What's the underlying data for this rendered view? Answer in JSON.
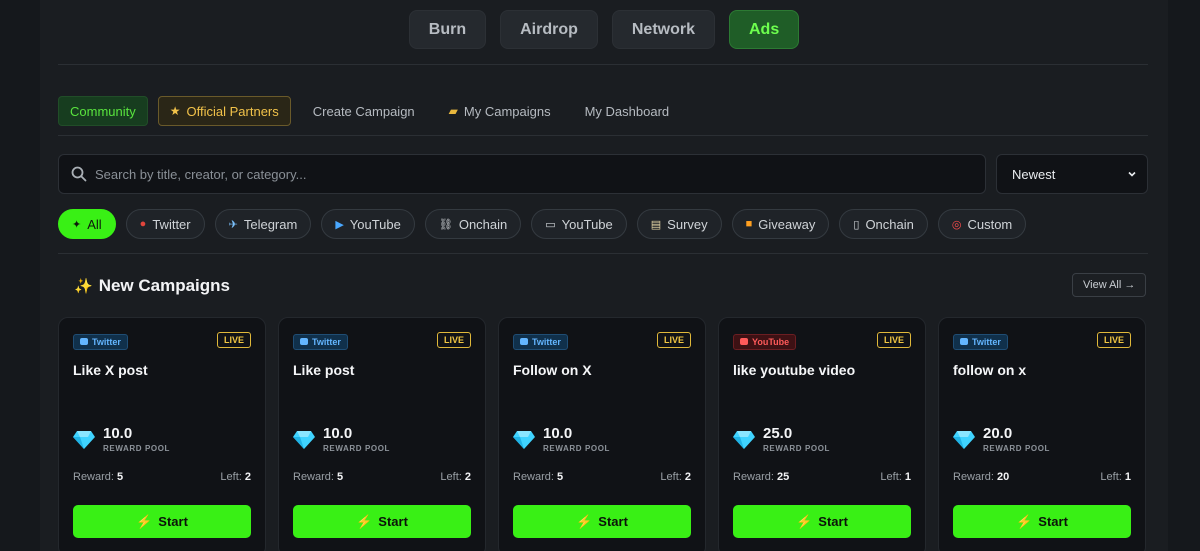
{
  "topnav": [
    {
      "label": "Burn",
      "active": false
    },
    {
      "label": "Airdrop",
      "active": false
    },
    {
      "label": "Network",
      "active": false
    },
    {
      "label": "Ads",
      "active": true
    }
  ],
  "subnav": {
    "community": "Community",
    "partners": "Official Partners",
    "create": "Create Campaign",
    "my_campaigns": "My Campaigns",
    "dashboard": "My Dashboard"
  },
  "search": {
    "placeholder": "Search by title, creator, or category..."
  },
  "sort": {
    "selected": "Newest"
  },
  "filters": [
    "All",
    "Twitter",
    "Telegram",
    "YouTube",
    "Onchain",
    "YouTube",
    "Survey",
    "Giveaway",
    "Onchain",
    "Custom"
  ],
  "section": {
    "title": "New Campaigns",
    "view_all": "View All →"
  },
  "cards": [
    {
      "platform": "Twitter",
      "status": "LIVE",
      "title": "Like X post",
      "pool": "10.0",
      "pool_label": "REWARD POOL",
      "reward_label": "Reward:",
      "reward": "5",
      "left_label": "Left:",
      "left": "2",
      "cta": "Start"
    },
    {
      "platform": "Twitter",
      "status": "LIVE",
      "title": "Like post",
      "pool": "10.0",
      "pool_label": "REWARD POOL",
      "reward_label": "Reward:",
      "reward": "5",
      "left_label": "Left:",
      "left": "2",
      "cta": "Start"
    },
    {
      "platform": "Twitter",
      "status": "LIVE",
      "title": "Follow on X",
      "pool": "10.0",
      "pool_label": "REWARD POOL",
      "reward_label": "Reward:",
      "reward": "5",
      "left_label": "Left:",
      "left": "2",
      "cta": "Start"
    },
    {
      "platform": "YouTube",
      "status": "LIVE",
      "title": "like youtube video",
      "pool": "25.0",
      "pool_label": "REWARD POOL",
      "reward_label": "Reward:",
      "reward": "25",
      "left_label": "Left:",
      "left": "1",
      "cta": "Start"
    },
    {
      "platform": "Twitter",
      "status": "LIVE",
      "title": "follow on x",
      "pool": "20.0",
      "pool_label": "REWARD POOL",
      "reward_label": "Reward:",
      "reward": "20",
      "left_label": "Left:",
      "left": "1",
      "cta": "Start"
    }
  ],
  "colors": {
    "accent": "#39f015",
    "live": "#f0c542",
    "twitter": "#63b5ff",
    "youtube": "#ff5a5a",
    "gem": "#3fd3ff"
  }
}
